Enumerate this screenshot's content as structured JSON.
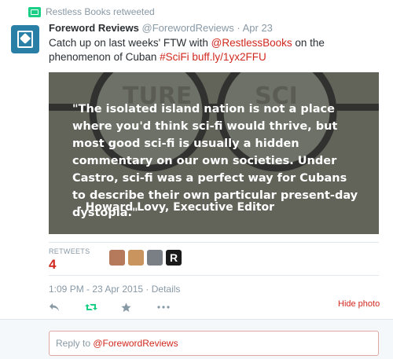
{
  "retweet": {
    "text": "Restless Books retweeted"
  },
  "tweet": {
    "name": "Foreword Reviews",
    "handle": "@ForewordReviews",
    "separator": "·",
    "date": "Apr 23",
    "text_prefix": "Catch up on last weeks' FTW with ",
    "mention": "@RestlessBooks",
    "text_middle": " on the phenomenon of Cuban ",
    "hashtag": "#SciFi",
    "url": "buff.ly/1yx2FFU"
  },
  "media": {
    "quote": "\"The isolated island nation is not a place where you'd think sci-fi would thrive, but most good sci-fi is usually a hidden commentary on our own societies. Under Castro, sci-fi was a perfect way for Cubans to describe their own particular present-day dystopia.\"",
    "attribution": "- Howard Lovy, Executive Editor",
    "glasses_text_left": "TURE",
    "glasses_text_right": "SCI"
  },
  "stats": {
    "label": "RETWEETS",
    "count": "4"
  },
  "retweeters": [
    {
      "color": "#b57a5c"
    },
    {
      "color": "#c9945e"
    },
    {
      "color": "#7a7f86"
    },
    {
      "color": "#1a1a1a",
      "letter": "R"
    }
  ],
  "timestamp": {
    "time": "1:09 PM - 23 Apr 2015",
    "separator": " · ",
    "details": "Details"
  },
  "actions": {
    "reply_icon": "reply-icon",
    "retweet_icon": "retweet-icon",
    "favorite_icon": "star-icon",
    "more_icon": "more-icon",
    "hide_photo": "Hide photo"
  },
  "reply": {
    "prefix": "Reply to ",
    "mention": "@ForewordReviews"
  },
  "colors": {
    "accent": "#d0281e",
    "retweet_green": "#19cf86",
    "muted": "#8899a6"
  }
}
